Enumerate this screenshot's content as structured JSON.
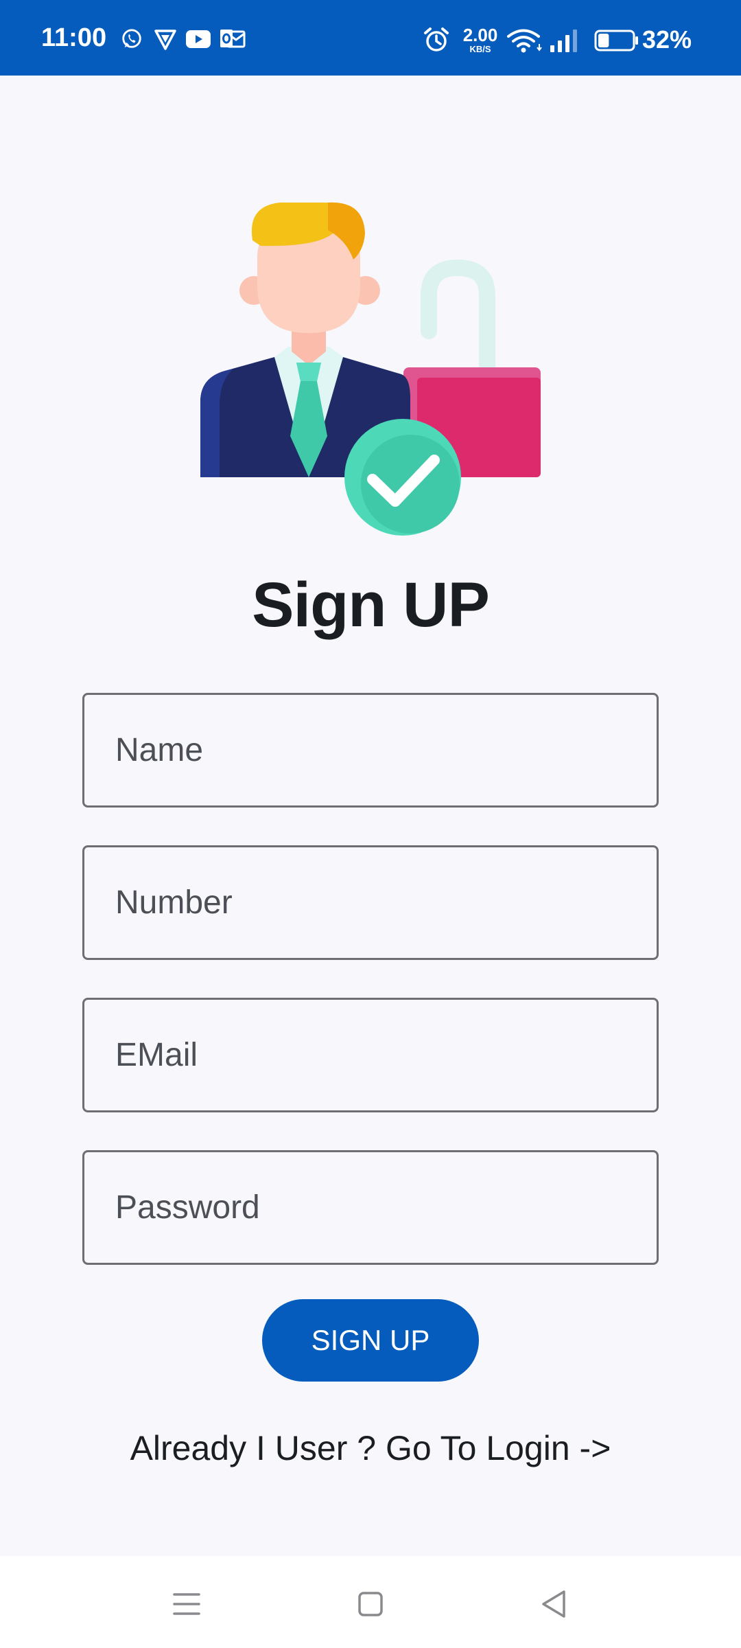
{
  "status_bar": {
    "time": "11:00",
    "net_speed_value": "2.00",
    "net_speed_unit": "KB/S",
    "battery_percent": "32%",
    "battery_level": 0.32,
    "notification_icons": [
      "whatsapp-icon",
      "vpn-icon",
      "youtube-icon",
      "outlook-icon"
    ],
    "system_icons": [
      "alarm-icon",
      "wifi-icon",
      "signal-icon",
      "battery-icon"
    ]
  },
  "title": "Sign UP",
  "form": {
    "name_placeholder": "Name",
    "number_placeholder": "Number",
    "email_placeholder": "EMail",
    "password_placeholder": "Password",
    "submit_label": "SIGN UP"
  },
  "login_link": "Already I User ? Go To Login ->",
  "nav_bar": [
    "menu-icon",
    "home-icon",
    "back-icon"
  ],
  "colors": {
    "primary": "#055cbd",
    "background": "#f7f7fc",
    "text": "#1a1d22",
    "field_border": "#6e6e74",
    "check_green": "#3fc9a9",
    "lock_pink": "#dd2a6d"
  }
}
